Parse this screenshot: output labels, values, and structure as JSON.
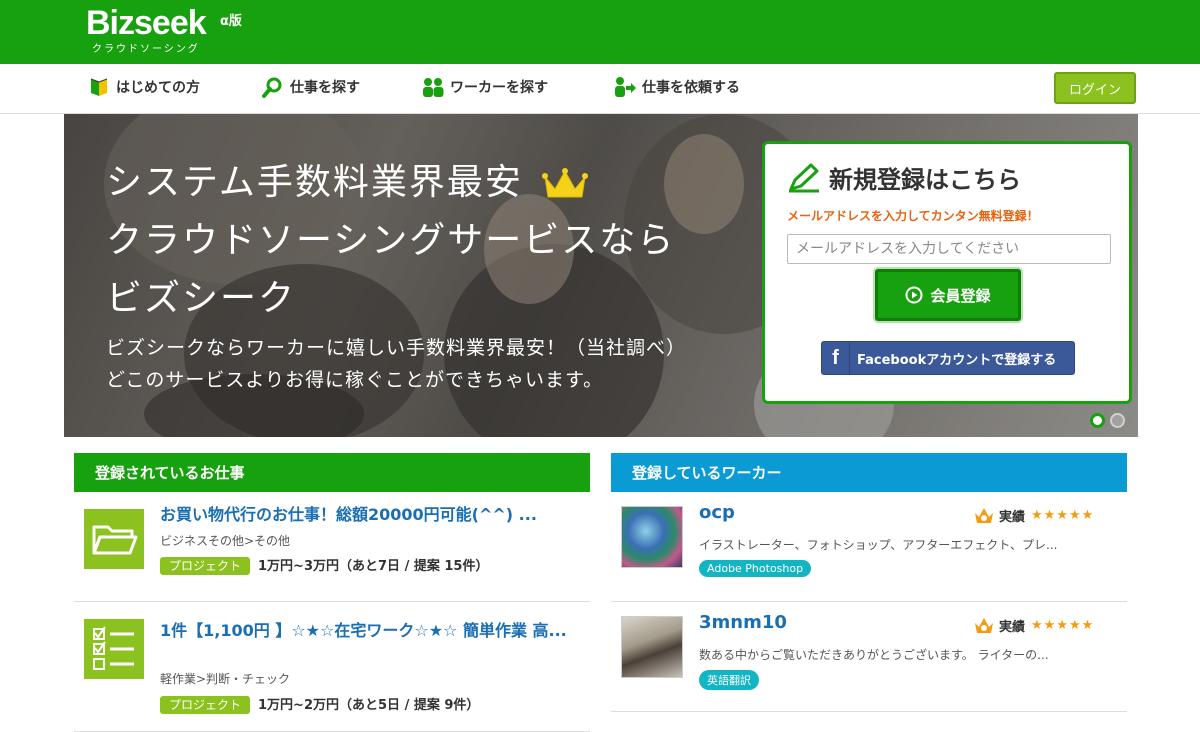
{
  "header": {
    "logo": "Bizseek",
    "logo_version": "α版",
    "logo_tagline": "クラウドソーシング"
  },
  "nav": {
    "items": [
      {
        "label": "はじめての方",
        "icon": "beginner-mark-icon"
      },
      {
        "label": "仕事を探す",
        "icon": "search-icon"
      },
      {
        "label": "ワーカーを探す",
        "icon": "people-icon"
      },
      {
        "label": "仕事を依頼する",
        "icon": "request-icon"
      }
    ],
    "login_label": "ログイン"
  },
  "hero": {
    "title_lines": [
      "システム手数料業界最安",
      "クラウドソーシングサービスなら",
      "ビズシーク"
    ],
    "subtitle_lines": [
      "ビズシークならワーカーに嬉しい手数料業界最安！（当社調べ）",
      "どこのサービスよりお得に稼ぐことができちゃいます。"
    ],
    "carousel_active_index": 0,
    "carousel_count": 2
  },
  "register": {
    "title": "新規登録はこちら",
    "note": "メールアドレスを入力してカンタン無料登録！",
    "email_placeholder": "メールアドレスを入力してください",
    "email_value": "",
    "submit_label": "会員登録",
    "facebook_label": "Facebookアカウントで登録する"
  },
  "jobs": {
    "heading": "登録されているお仕事",
    "items": [
      {
        "title": "お買い物代行のお仕事！総額20000円可能(^^) ...",
        "category": "ビジネスその他>その他",
        "type": "プロジェクト",
        "budget": "1万円~3万円（あと7日 / 提案 15件）",
        "icon": "folder-icon"
      },
      {
        "title": "1件【1,100円 】☆★☆在宅ワーク☆★☆ 簡単作業 高...",
        "category": "軽作業>判断・チェック",
        "type": "プロジェクト",
        "budget": "1万円~2万円（あと5日 / 提案 9件）",
        "icon": "checklist-icon"
      }
    ]
  },
  "workers": {
    "heading": "登録しているワーカー",
    "items": [
      {
        "name": "ocp",
        "record_label": "実績",
        "rating": 5,
        "description": "イラストレーター、フォトショップ、アフターエフェクト、プレ...",
        "skill": "Adobe Photoshop"
      },
      {
        "name": "3mnm10",
        "record_label": "実績",
        "rating": 5,
        "description": "数ある中からご覧いただきありがとうございます。 ライターの...",
        "skill": "英語翻訳"
      }
    ]
  },
  "colors": {
    "brand_green": "#18a10e",
    "login_green": "#8cc21f",
    "worker_blue": "#0a9bd4",
    "note_orange": "#e8620f",
    "facebook_blue": "#3b5998",
    "skill_teal": "#13b5c2"
  }
}
